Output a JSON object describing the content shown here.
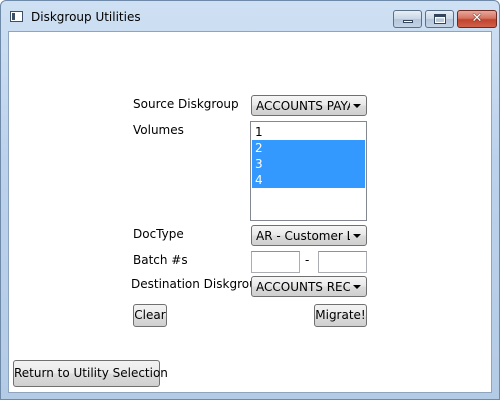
{
  "window": {
    "title": "Diskgroup Utilities",
    "controls": {
      "minimize_icon": "minimize-icon",
      "maximize_icon": "maximize-icon",
      "close_icon": "close-icon",
      "close_glyph": "✕"
    }
  },
  "form": {
    "source_diskgroup": {
      "label": "Source Diskgroup",
      "value": "ACCOUNTS PAYABLE"
    },
    "volumes": {
      "label": "Volumes",
      "items": [
        {
          "label": "1",
          "selected": false
        },
        {
          "label": "2",
          "selected": true
        },
        {
          "label": "3",
          "selected": true
        },
        {
          "label": "4",
          "selected": true
        }
      ]
    },
    "doctype": {
      "label": "DocType",
      "value": "AR - Customer Letters"
    },
    "batch": {
      "label": "Batch #s",
      "from_value": "",
      "separator": "-",
      "to_value": ""
    },
    "destination_diskgroup": {
      "label": "Destination Diskgroup",
      "value": "ACCOUNTS RECEIVABLE"
    },
    "clear_label": "Clear",
    "migrate_label": "Migrate!"
  },
  "footer": {
    "return_label": "Return to Utility Selection"
  },
  "colors": {
    "selection": "#3399ff",
    "title_bar": "#bcd2ec",
    "close_button": "#c2432d"
  }
}
